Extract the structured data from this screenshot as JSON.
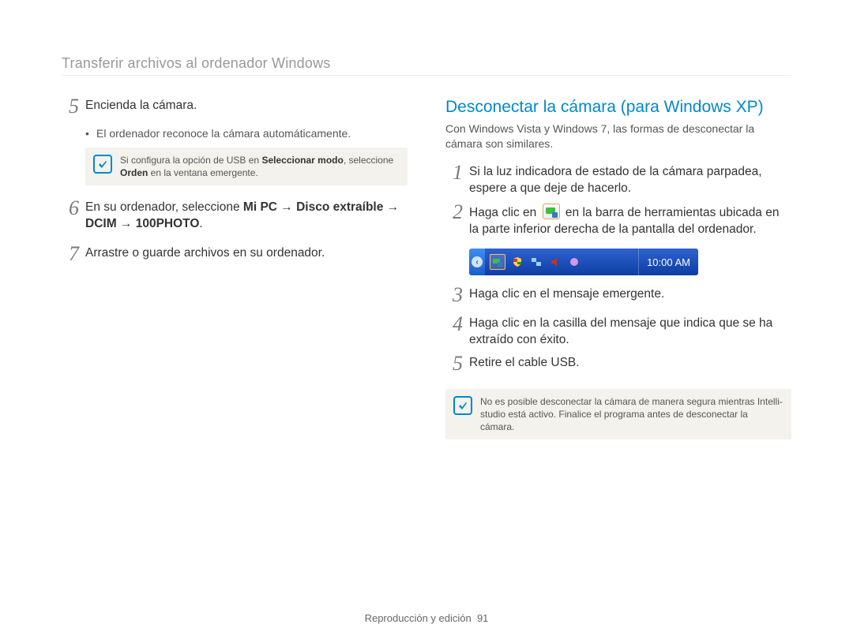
{
  "header": "Transferir archivos al ordenador Windows",
  "left": {
    "steps": {
      "s5": {
        "num": "5",
        "text": "Encienda la cámara."
      },
      "s5_bullet": "El ordenador reconoce la cámara automáticamente.",
      "s5_note_pre": "Si configura la opción de USB en ",
      "s5_note_bold1": "Seleccionar modo",
      "s5_note_mid": ", seleccione ",
      "s5_note_bold2": "Orden",
      "s5_note_post": " en la ventana emergente.",
      "s6": {
        "num": "6",
        "pre": "En su ordenador, seleccione ",
        "bold": "Mi PC → Disco extraíble → DCIM → 100PHOTO",
        "post": "."
      },
      "s7": {
        "num": "7",
        "text": "Arrastre o guarde archivos en su ordenador."
      }
    }
  },
  "right": {
    "title": "Desconectar la cámara (para Windows XP)",
    "subtitle": "Con Windows Vista y Windows 7, las formas de desconectar la cámara son similares.",
    "steps": {
      "s1": {
        "num": "1",
        "text": "Si la luz indicadora de estado de la cámara parpadea, espere a que deje de hacerlo."
      },
      "s2": {
        "num": "2",
        "pre": "Haga clic en ",
        "post": " en la barra de herramientas ubicada en la parte inferior derecha de la pantalla del ordenador."
      },
      "s3": {
        "num": "3",
        "text": "Haga clic en el mensaje emergente."
      },
      "s4": {
        "num": "4",
        "text": "Haga clic en la casilla del mensaje que indica que se ha extraído con éxito."
      },
      "s5": {
        "num": "5",
        "text": "Retire el cable USB."
      }
    },
    "systray": {
      "clock": "10:00 AM"
    },
    "note": "No es posible desconectar la cámara de manera segura mientras Intelli-studio está activo. Finalice el programa antes de desconectar la cámara."
  },
  "footer": {
    "section": "Reproducción y edición",
    "page": "91"
  }
}
